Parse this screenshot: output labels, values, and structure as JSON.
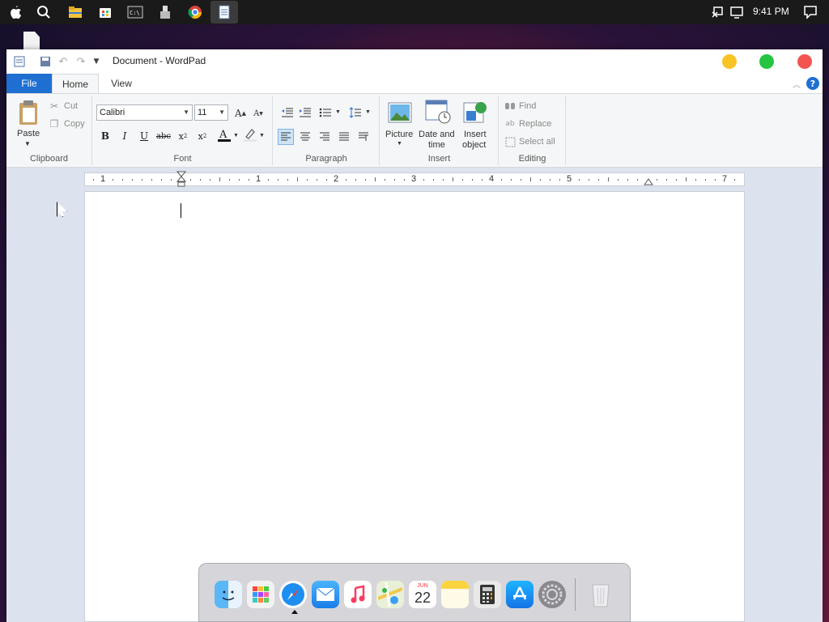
{
  "topbar": {
    "clock": "9:41 PM",
    "icons": [
      "apple-icon",
      "search-icon",
      "file-explorer-icon",
      "store-icon",
      "terminal-icon",
      "usb-device-icon",
      "chrome-icon",
      "wordpad-icon"
    ],
    "right_icons": [
      "network-off-icon",
      "display-icon",
      "notification-icon"
    ]
  },
  "window": {
    "title": "Document - WordPad",
    "quick_access": [
      "save-icon",
      "undo-icon",
      "redo-icon",
      "customize-icon"
    ],
    "controls": {
      "minimize_color": "#f7c325",
      "maximize_color": "#26c541",
      "close_color": "#f25550"
    }
  },
  "ribbon": {
    "tabs": [
      "File",
      "Home",
      "View"
    ],
    "active_tab": "Home",
    "clipboard": {
      "label": "Clipboard",
      "paste": "Paste",
      "cut": "Cut",
      "copy": "Copy"
    },
    "font": {
      "label": "Font",
      "family": "Calibri",
      "size": "11",
      "bold": "B",
      "italic": "I",
      "underline": "U",
      "strike": "abc"
    },
    "paragraph": {
      "label": "Paragraph"
    },
    "insert": {
      "label": "Insert",
      "picture": "Picture",
      "date_time_line1": "Date and",
      "date_time_line2": "time",
      "object_line1": "Insert",
      "object_line2": "object"
    },
    "editing": {
      "label": "Editing",
      "find": "Find",
      "replace": "Replace",
      "select_all": "Select all"
    }
  },
  "ruler": {
    "numbers": [
      "1",
      "1",
      "2",
      "3",
      "4",
      "5",
      "7"
    ]
  },
  "dock": {
    "apps": [
      "finder",
      "launchpad",
      "safari",
      "mail",
      "music",
      "maps",
      "calendar",
      "notes",
      "calculator",
      "app-store",
      "system-settings",
      "trash"
    ],
    "calendar_month": "JUN",
    "calendar_day": "22"
  }
}
